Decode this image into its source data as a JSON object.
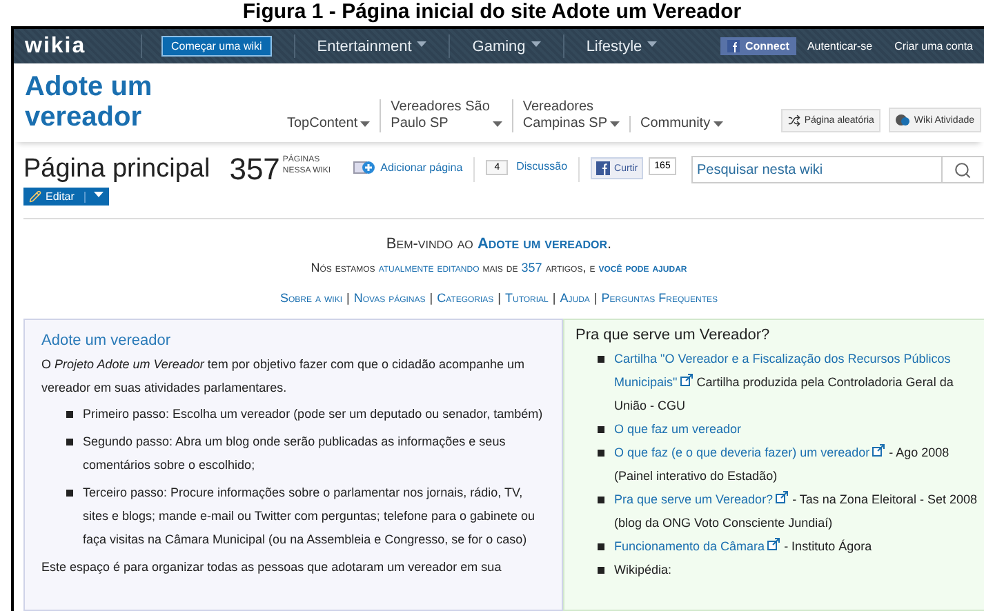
{
  "caption": "Figura 1 - Página inicial do site Adote um Vereador",
  "topbar": {
    "logo": "wikia",
    "start_button": "Começar uma wiki",
    "menus": [
      "Entertainment",
      "Gaming",
      "Lifestyle"
    ],
    "connect": "Connect",
    "links": [
      "Autenticar-se",
      "Criar uma conta"
    ]
  },
  "wiki": {
    "title": "Adote um vereador",
    "nav": [
      [
        "TopContent"
      ],
      [
        "Vereadores São",
        "Paulo SP"
      ],
      [
        "Vereadores",
        "Campinas SP"
      ],
      [
        "Community"
      ]
    ],
    "buttons": [
      {
        "label": "Página aleatória",
        "kind": "random"
      },
      {
        "label": "Wiki Atividade",
        "kind": "activity"
      }
    ]
  },
  "page": {
    "title": "Página principal",
    "count": "357",
    "count_label": [
      "PÁGINAS",
      "NESSA WIKI"
    ],
    "add_page": "Adicionar página",
    "comments": "4",
    "discussion": "Discussão",
    "like": "Curtir",
    "likes": "165",
    "search": {
      "placeholder": "Pesquisar nesta wiki"
    },
    "edit": "Editar"
  },
  "welcome": {
    "lines": [
      [
        {
          "text": "Bem-vindo ao ",
          "link": false,
          "bold": false
        },
        {
          "text": "Adote um vereador",
          "link": true,
          "bold": true
        },
        {
          "text": ".",
          "link": false,
          "bold": false
        }
      ],
      [
        {
          "text": "Nós estamos ",
          "link": false,
          "bold": false
        },
        {
          "text": "atualmente editando",
          "link": true,
          "bold": false
        },
        {
          "text": " mais de ",
          "link": false,
          "bold": false
        },
        {
          "text": "357",
          "link": true,
          "bold": false
        },
        {
          "text": " artigos, e ",
          "link": false,
          "bold": false
        },
        {
          "text": "você pode ajudar",
          "link": true,
          "bold": true
        }
      ]
    ],
    "links": [
      "Sobre a wiki",
      "Novas páginas",
      "Categorias",
      "Tutorial",
      "Ajuda",
      "Perguntas Frequentes"
    ],
    "separator": "|"
  },
  "left_box": {
    "title": "Adote um vereador",
    "intro": "O *Projeto Adote um Vereador* tem por objetivo fazer com que o cidadão acompanhe um vereador em suas atividades parlamentares.",
    "steps": [
      "Primeiro passo: Escolha um vereador (pode ser um deputado ou senador, também)",
      "Segundo passo: Abra um blog onde serão publicadas as informações e seus comentários sobre o escolhido;",
      "Terceiro passo: Procure informações sobre o parlamentar nos jornais, rádio, TV, sites e blogs; mande e-mail ou Twitter com perguntas; telefone para o gabinete ou faça visitas na Câmara Municipal (ou na Assembleia e Congresso, se for o caso)"
    ],
    "outro": "Este espaço é para organizar todas as pessoas que adotaram um vereador em sua"
  },
  "right_box": {
    "title": "Pra que serve um Vereador?",
    "items": [
      {
        "link": [
          "Cartilha \"O Vereador e a Fiscalização dos Recursos Públicos",
          "Municipais\""
        ],
        "external": true,
        "text": "Cartilha produzida pela Controladoria Geral da União - CGU"
      },
      {
        "link": [
          "O que faz um vereador"
        ],
        "external": false
      },
      {
        "link": [
          "O que faz (e o que deveria fazer) um vereador"
        ],
        "external": true,
        "text": "- Ago 2008 (Painel interativo do Estadão)"
      },
      {
        "link": [
          "Pra que serve um Vereador?"
        ],
        "external": true,
        "text": "- Tas na Zona Eleitoral - Set 2008 (blog da ONG Voto Consciente Jundiaí)"
      },
      {
        "link": [
          "Funcionamento da Câmara"
        ],
        "external": true,
        "text": "- Instituto Ágora"
      },
      {
        "text": "Wikipédia:",
        "external": false
      }
    ]
  }
}
